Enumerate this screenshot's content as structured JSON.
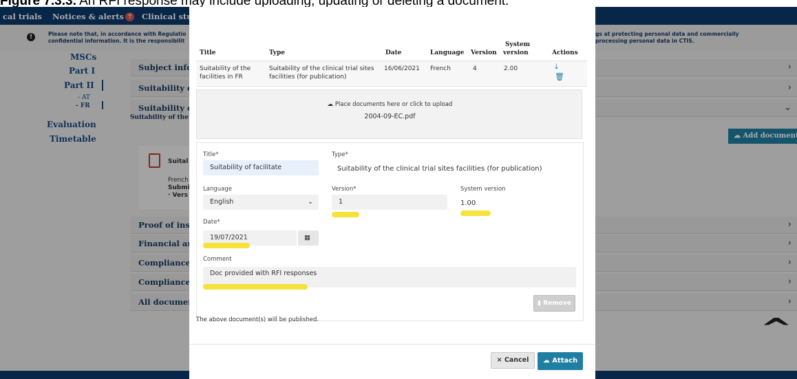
{
  "caption": {
    "label": "Figure 7.3.3.",
    "text": " An RFI response may include uploading, updating or deleting a document."
  },
  "topnav": {
    "items": [
      "cal trials",
      "Notices & alerts",
      "Clinical stud"
    ],
    "badge": "7"
  },
  "notice": {
    "line1a": "Please note that, in accordance with Regulatio",
    "line1b": "confidential information. It is the responsibilit",
    "line2a": "gs at protecting personal data and commercially",
    "line2b": "processing personal data in CTIS."
  },
  "leftnav": {
    "items": [
      "MSCs",
      "Part I",
      "Part II",
      "- AT",
      "- FR",
      "Evaluation",
      "Timetable"
    ]
  },
  "accordion": {
    "items": [
      "Subject infor",
      "Suitability of",
      "Suitability of",
      "Proof of insu",
      "Financial and",
      "Compliance v",
      "Compliance v",
      "All document"
    ],
    "sub_label": "Suitability of the"
  },
  "doc_card": {
    "title": "Suital",
    "lang": "French",
    "submitted": "Submi",
    "version": "· Vers"
  },
  "add_document": "Add document",
  "modal": {
    "table": {
      "headers": [
        "Title",
        "Type",
        "Date",
        "Language",
        "Version",
        "System",
        "version",
        "Actions"
      ],
      "row": {
        "title1": "Suitability of the",
        "title2": "facilities in FR",
        "type1": "Suitability of the clinical trial sites",
        "type2": "facilities (for publication)",
        "date": "16/06/2021",
        "language": "French",
        "version": "4",
        "system_version": "2.00"
      }
    },
    "dropzone": {
      "text": "Place documents here or click to upload",
      "file": "2004-09-EC.pdf"
    },
    "form": {
      "title_label": "Title*",
      "title_value": "Suitability of facilitate",
      "type_label": "Type*",
      "type_value": "Suitability of the clinical trial sites facilities (for publication)",
      "language_label": "Language",
      "language_value": "English",
      "version_label": "Version*",
      "version_value": "1",
      "sysver_label": "System version",
      "sysver_value": "1.00",
      "date_label": "Date*",
      "date_value": "19/07/2021",
      "comment_label": "Comment",
      "comment_value": "Doc provided with RFI responses"
    },
    "remove": "Remove",
    "note": "The above document(s) will be published.",
    "cancel": "Cancel",
    "attach": "Attach"
  },
  "colors": {
    "navy": "#0d3a6b",
    "accent": "#1e7fa2",
    "highlight": "#f7e23b",
    "input_bg": "#e8f0fb"
  }
}
